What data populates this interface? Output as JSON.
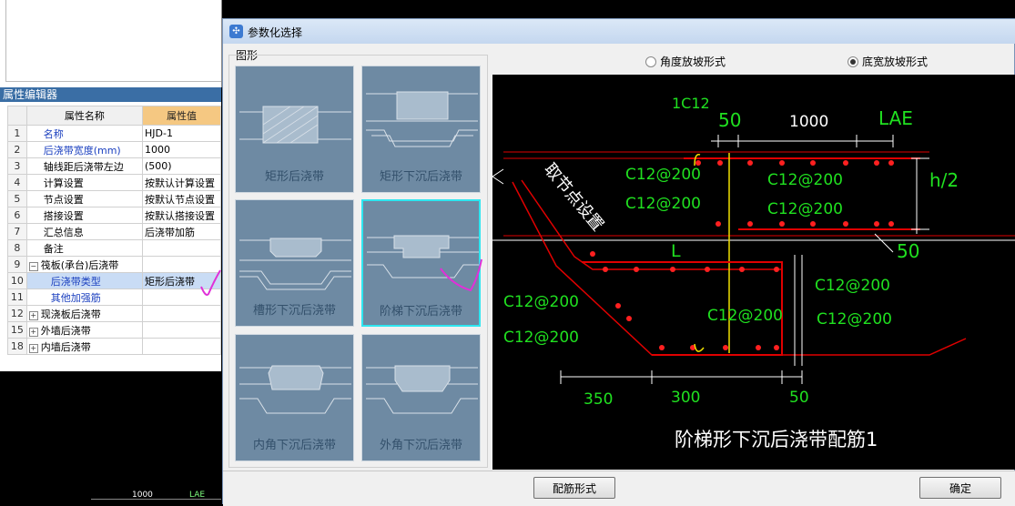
{
  "properties_panel": {
    "title": "属性编辑器",
    "headers": {
      "name": "属性名称",
      "value": "属性值"
    },
    "rows": [
      {
        "num": "1",
        "name": "名称",
        "value": "HJD-1",
        "blue": true,
        "selected": false
      },
      {
        "num": "2",
        "name": "后浇带宽度(mm)",
        "value": "1000",
        "blue": true,
        "selected": false
      },
      {
        "num": "3",
        "name": "轴线距后浇带左边",
        "value": "(500)",
        "blue": false,
        "selected": false
      },
      {
        "num": "4",
        "name": "计算设置",
        "value": "按默认计算设置",
        "blue": false,
        "selected": false
      },
      {
        "num": "5",
        "name": "节点设置",
        "value": "按默认节点设置",
        "blue": false,
        "selected": false
      },
      {
        "num": "6",
        "name": "搭接设置",
        "value": "按默认搭接设置",
        "blue": false,
        "selected": false
      },
      {
        "num": "7",
        "name": "汇总信息",
        "value": "后浇带加筋",
        "blue": false,
        "selected": false
      },
      {
        "num": "8",
        "name": "备注",
        "value": "",
        "blue": false,
        "selected": false
      },
      {
        "num": "9",
        "name": "筏板(承台)后浇带",
        "value": "",
        "blue": false,
        "selected": false
      },
      {
        "num": "10",
        "name": "后浇带类型",
        "value": "矩形后浇带",
        "blue": true,
        "selected": true
      },
      {
        "num": "11",
        "name": "其他加强筋",
        "value": "",
        "blue": true,
        "selected": false
      },
      {
        "num": "12",
        "name": "现浇板后浇带",
        "value": "",
        "blue": false,
        "selected": false
      },
      {
        "num": "15",
        "name": "外墙后浇带",
        "value": "",
        "blue": false,
        "selected": false
      },
      {
        "num": "18",
        "name": "内墙后浇带",
        "value": "",
        "blue": false,
        "selected": false
      }
    ],
    "bottom_dims": {
      "width": "1000",
      "lae": "LAE"
    }
  },
  "dialog": {
    "title": "参数化选择",
    "group_label": "图形",
    "thumbnails": [
      {
        "label": "矩形后浇带"
      },
      {
        "label": "矩形下沉后浇带"
      },
      {
        "label": "槽形下沉后浇带"
      },
      {
        "label": "阶梯下沉后浇带"
      },
      {
        "label": "内角下沉后浇带"
      },
      {
        "label": "外角下沉后浇带"
      }
    ],
    "radio_options": [
      {
        "label": "角度放坡形式",
        "checked": false
      },
      {
        "label": "底宽放坡形式",
        "checked": true
      }
    ],
    "buttons": {
      "rebar_form": "配筋形式",
      "ok": "确定"
    }
  },
  "drawing": {
    "title": "阶梯形下沉后浇带配筋1",
    "labels": {
      "top_bar": "1C12",
      "dim_50_top": "50",
      "dim_1000": "1000",
      "lae": "LAE",
      "h2": "h/2",
      "node": "取节点设置",
      "L": "L",
      "dim_50_right": "50",
      "dim_350": "350",
      "dim_300": "300",
      "dim_50_bottom": "50"
    },
    "rebar_labels": {
      "left_top_1": "C12@200",
      "left_top_2": "C12@200",
      "mid_top_1": "C12@200",
      "mid_top_2": "C12@200",
      "left_bot_1": "C12@200",
      "left_bot_2": "C12@200",
      "center_bot": "C12@200",
      "right_bot_1": "C12@200",
      "right_bot_2": "C12@200"
    },
    "colors": {
      "concrete": "#e00000",
      "rebar_dot": "#ff2020",
      "text_green": "#20e020",
      "dim_white": "#ffffff",
      "axis_yellow": "#f0e000"
    }
  }
}
